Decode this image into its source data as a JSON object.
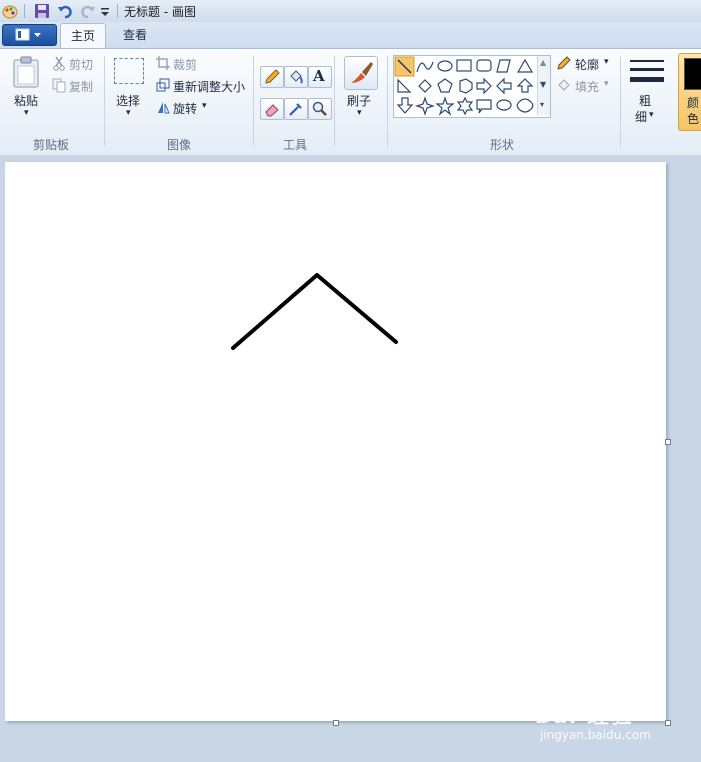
{
  "window": {
    "title": "无标题 - 画图"
  },
  "tabs": [
    {
      "label": "主页"
    },
    {
      "label": "查看"
    }
  ],
  "clipboard": {
    "paste_label": "粘贴",
    "cut_label": "剪切",
    "copy_label": "复制",
    "group_label": "剪贴板"
  },
  "image": {
    "select_label": "选择",
    "crop_label": "裁剪",
    "resize_label": "重新调整大小",
    "rotate_label": "旋转",
    "group_label": "图像"
  },
  "tools": {
    "group_label": "工具",
    "text_glyph": "A"
  },
  "brushes": {
    "label": "刷子"
  },
  "shapes": {
    "outline_label": "轮廓",
    "fill_label": "填充",
    "group_label": "形状"
  },
  "size": {
    "label_line1": "粗",
    "label_line2": "细"
  },
  "colors": {
    "label_line1": "颜",
    "label_line2": "色",
    "accent": "#f5c463"
  },
  "watermark": {
    "brand": "Bai 经验",
    "url": "jingyan.baidu.com"
  }
}
